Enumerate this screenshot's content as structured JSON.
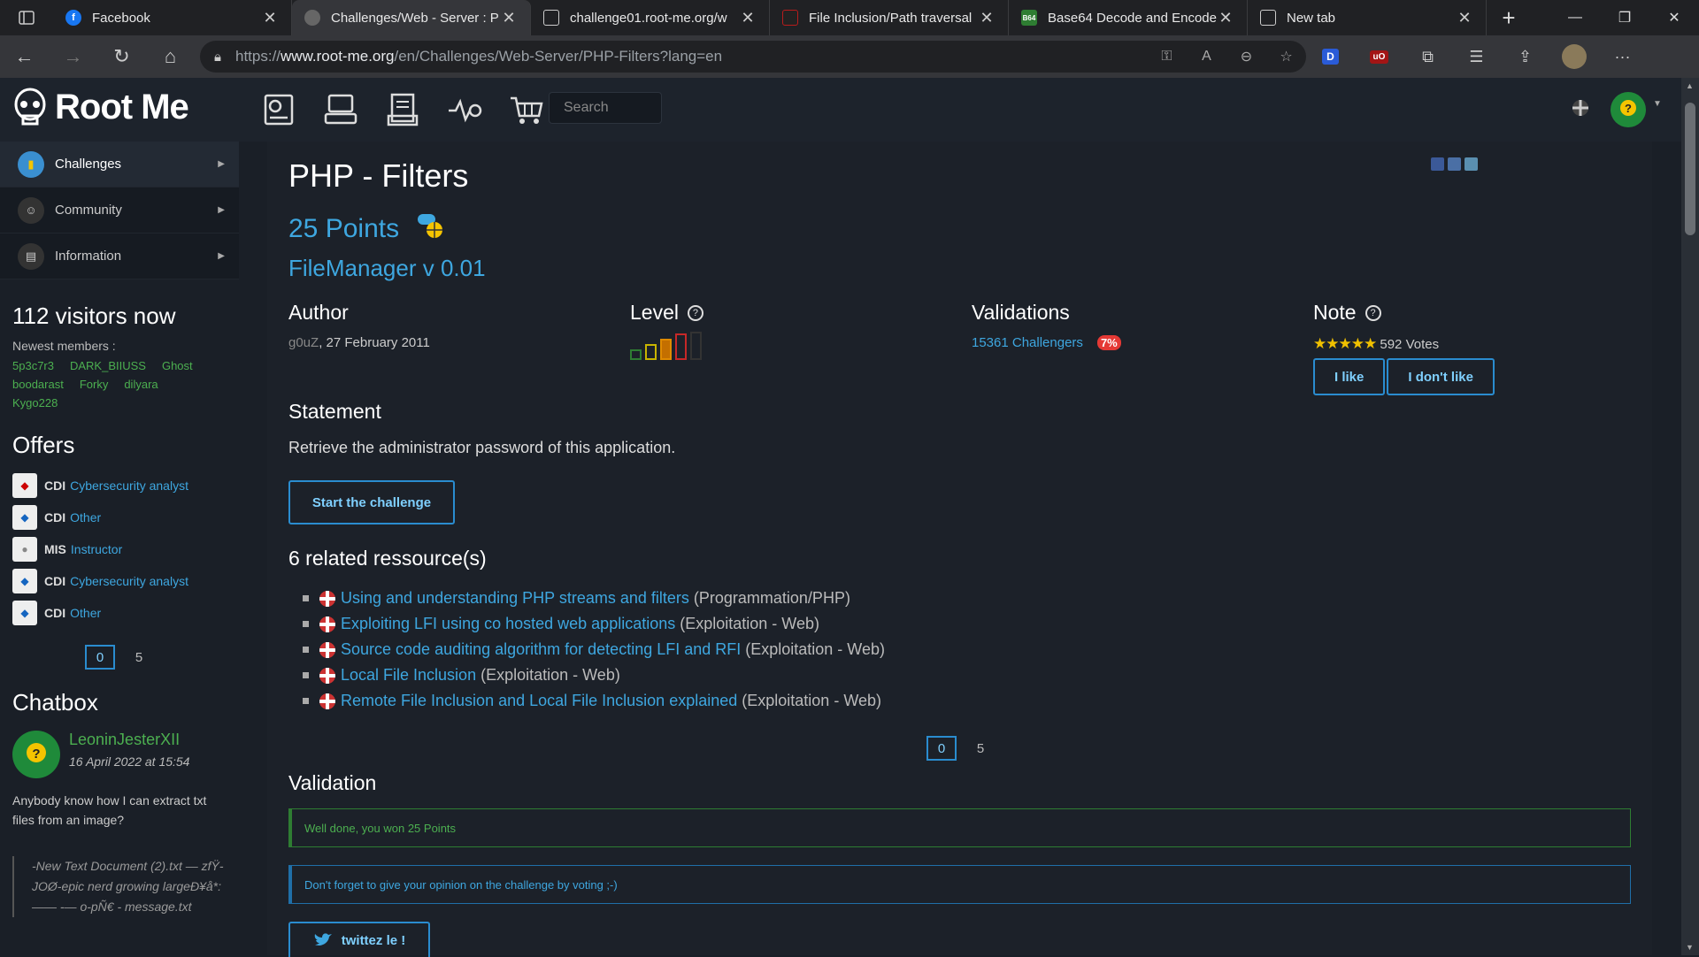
{
  "browser": {
    "tabs": [
      {
        "title": "Facebook",
        "fav_color": "#1877f2",
        "fav_text": "f"
      },
      {
        "title": "Challenges/Web - Server : P",
        "fav_color": "#555",
        "fav_text": ""
      },
      {
        "title": "challenge01.root-me.org/w",
        "fav_color": "#555",
        "fav_text": ""
      },
      {
        "title": "File Inclusion/Path traversal",
        "fav_color": "#b71c1c",
        "fav_text": ""
      },
      {
        "title": "Base64 Decode and Encode",
        "fav_color": "#2e7d32",
        "fav_text": "B64"
      },
      {
        "title": "New tab",
        "fav_color": "#555",
        "fav_text": ""
      }
    ],
    "url_prefix": "https://",
    "url_domain": "www.root-me.org",
    "url_path": "/en/Challenges/Web-Server/PHP-Filters?lang=en"
  },
  "header": {
    "logo_text": "Root Me",
    "search_placeholder": "Search"
  },
  "sidebar": {
    "menu": [
      {
        "label": "Challenges"
      },
      {
        "label": "Community"
      },
      {
        "label": "Information"
      }
    ],
    "visitors": "112 visitors now",
    "newest_label": "Newest members :",
    "members": [
      "5p3c7r3",
      "DARK_BIIUSS",
      "Ghost",
      "boodarast",
      "Forky",
      "dilyara",
      "Kygo228"
    ],
    "offers_title": "Offers",
    "offers": [
      {
        "type": "CDI",
        "job": "Cybersecurity analyst"
      },
      {
        "type": "CDI",
        "job": "Other"
      },
      {
        "type": "MIS",
        "job": "Instructor"
      },
      {
        "type": "CDI",
        "job": "Cybersecurity analyst"
      },
      {
        "type": "CDI",
        "job": "Other"
      }
    ],
    "offers_pages": [
      "0",
      "5"
    ],
    "chatbox_title": "Chatbox",
    "chat_user": "LeoninJesterXII",
    "chat_date": "16 April 2022 at 15:54",
    "chat_msg": "Anybody know how I can extract txt files from an image?",
    "chat_quote": "-New Text Document (2).txt — zfŸ-JOØ-epic nerd growing largeÐ¥å*:—— -— o-pÑ€ - message.txt"
  },
  "challenge": {
    "title": "PHP - Filters",
    "points": "25 Points",
    "subtitle": "FileManager v 0.01",
    "author_h": "Author",
    "author": "g0uZ",
    "author_date": ",  27 February 2011",
    "level_h": "Level",
    "validations_h": "Validations",
    "validations": "15361 Challengers",
    "validations_pct": "7%",
    "note_h": "Note",
    "votes": "592 Votes",
    "like_label": "I like",
    "dislike_label": "I don't like",
    "statement_h": "Statement",
    "statement": "Retrieve the administrator password of this application.",
    "start_label": "Start the challenge",
    "resources_h": "6 related ressource(s)",
    "resources": [
      {
        "title": "Using and understanding PHP streams and filters",
        "cat": "(Programmation/PHP)"
      },
      {
        "title": "Exploiting LFI using co hosted web applications",
        "cat": "(Exploitation - Web)"
      },
      {
        "title": "Source code auditing algorithm for detecting LFI and RFI",
        "cat": "(Exploitation - Web)"
      },
      {
        "title": "Local File Inclusion",
        "cat": "(Exploitation - Web)"
      },
      {
        "title": "Remote File Inclusion and Local File Inclusion explained",
        "cat": "(Exploitation - Web)"
      }
    ],
    "resources_pages": [
      "0",
      "5"
    ],
    "validation_h": "Validation",
    "won_msg": "Well done, you won 25 Points",
    "vote_msg": "Don't forget to give your opinion on the challenge by voting ;-)",
    "tweet_label": "twittez le !"
  }
}
